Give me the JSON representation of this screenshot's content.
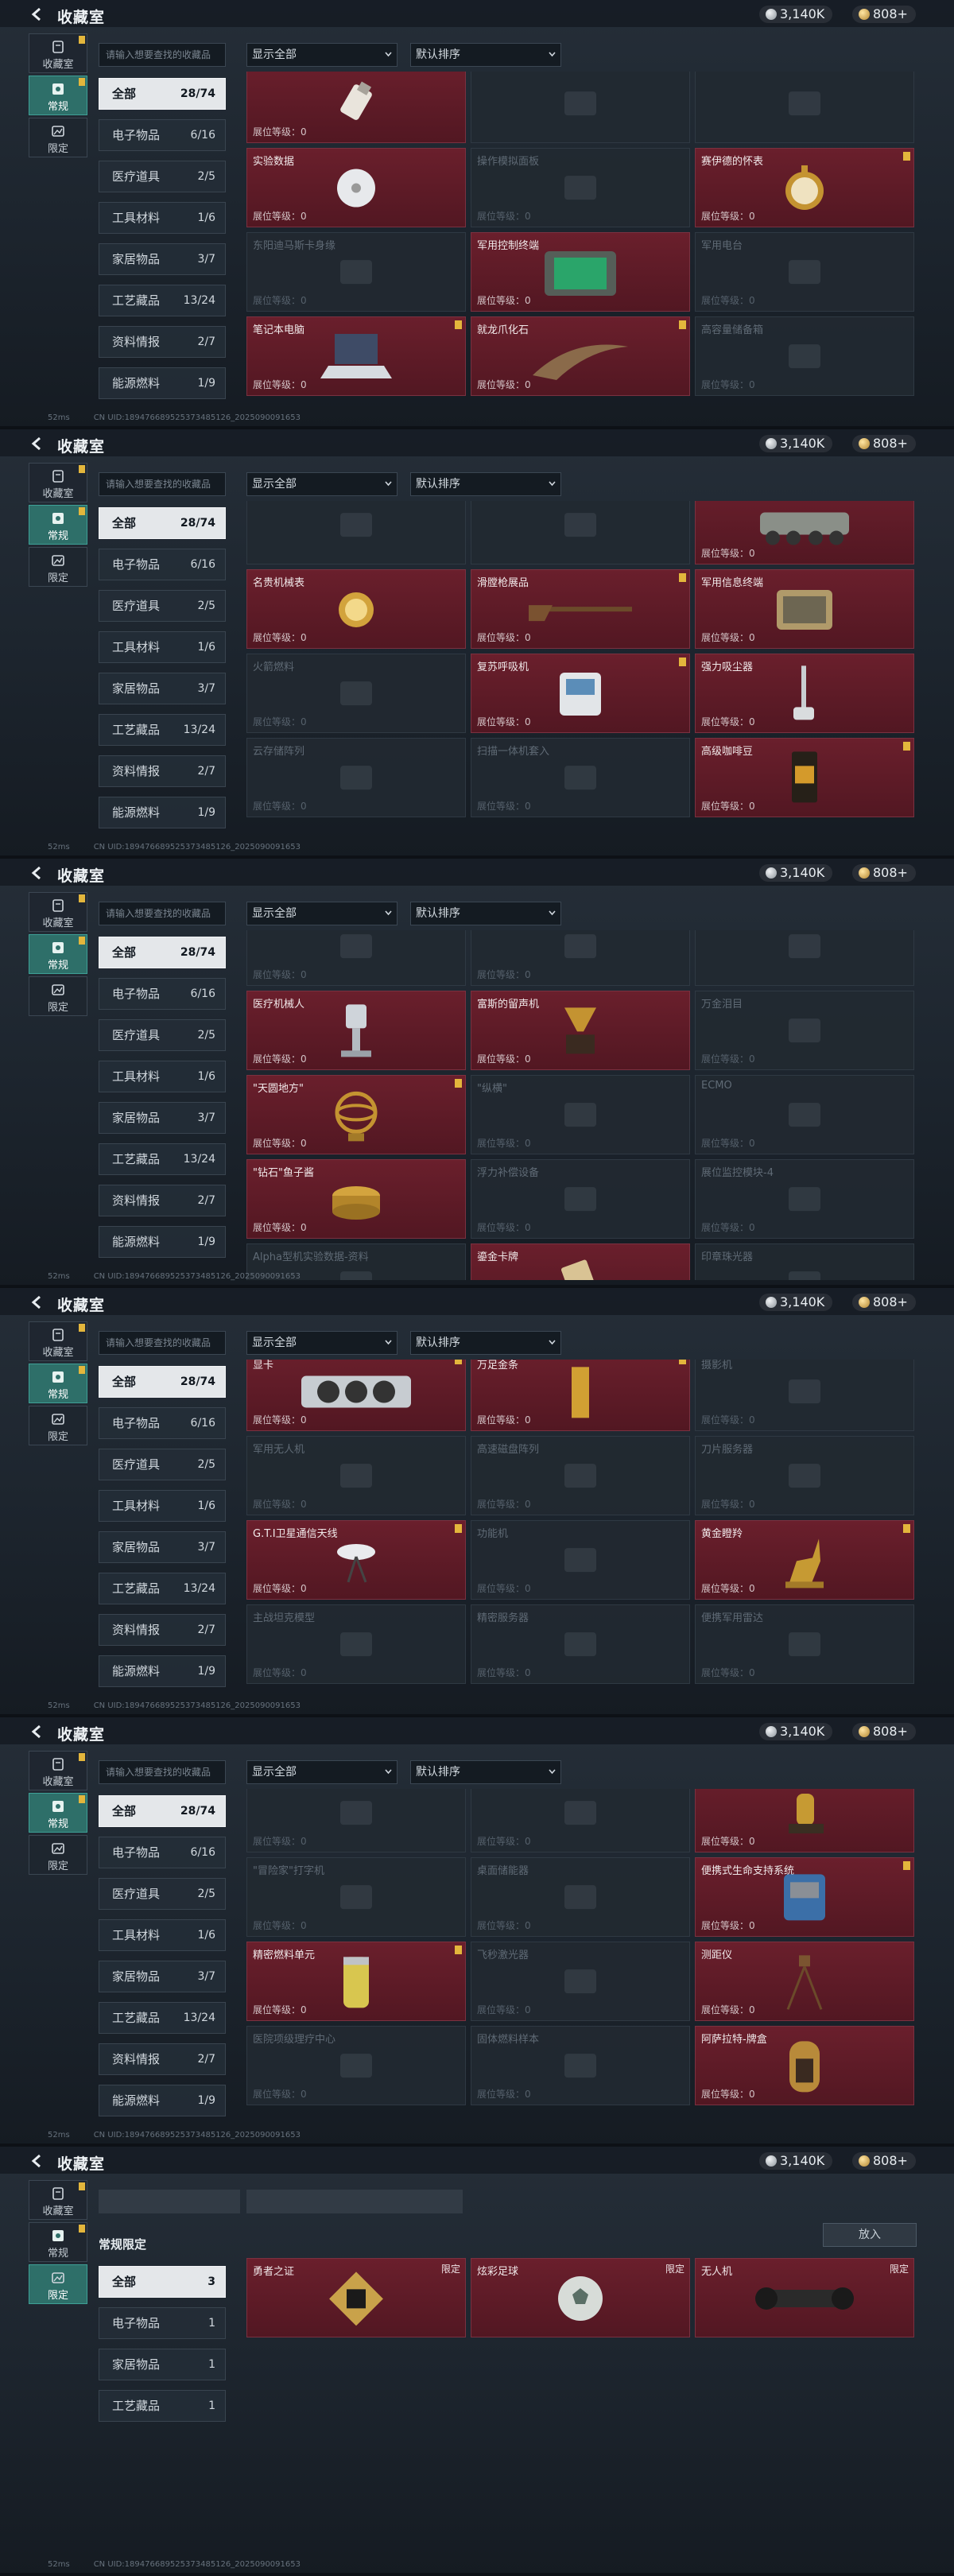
{
  "header": {
    "title": "收藏室",
    "silver_amount": "3,140K",
    "gold_amount": "808+"
  },
  "sidebar": [
    {
      "label": "收藏室",
      "icon": "collection-room-icon"
    },
    {
      "label": "常规",
      "icon": "regular-icon"
    },
    {
      "label": "限定",
      "icon": "limited-icon"
    }
  ],
  "filters": {
    "search_placeholder": "请输入想要查找的收藏品",
    "show_all": "显示全部",
    "sort": "默认排序"
  },
  "categories": [
    {
      "label": "全部",
      "count": "28/74"
    },
    {
      "label": "电子物品",
      "count": "6/16"
    },
    {
      "label": "医疗道具",
      "count": "2/5"
    },
    {
      "label": "工具材料",
      "count": "1/6"
    },
    {
      "label": "家居物品",
      "count": "3/7"
    },
    {
      "label": "工艺藏品",
      "count": "13/24"
    },
    {
      "label": "资料情报",
      "count": "2/7"
    },
    {
      "label": "能源燃料",
      "count": "1/9"
    }
  ],
  "level_label": "展位等级：",
  "footer": {
    "ping": "52ms",
    "uid": "CN UID:189476689525373485126_2025090091653"
  },
  "screens": [
    [
      {
        "name": "",
        "owned": true,
        "level": "0",
        "icon": "usb-drive"
      },
      {
        "name": "",
        "owned": false,
        "level": "",
        "icon": "none"
      },
      {
        "name": "",
        "owned": false,
        "level": "",
        "icon": "none"
      },
      {
        "name": "实验数据",
        "owned": true,
        "level": "0",
        "icon": "disc"
      },
      {
        "name": "操作模拟面板",
        "owned": false,
        "level": "0",
        "icon": "none"
      },
      {
        "name": "赛伊德的怀表",
        "owned": true,
        "level": "0",
        "icon": "pocket-watch",
        "badge": true
      },
      {
        "name": "东阳迪马斯卡身缘",
        "owned": false,
        "level": "0",
        "icon": "none"
      },
      {
        "name": "军用控制终端",
        "owned": true,
        "level": "0",
        "icon": "control-terminal"
      },
      {
        "name": "军用电台",
        "owned": false,
        "level": "0",
        "icon": "none"
      },
      {
        "name": "笔记本电脑",
        "owned": true,
        "level": "0",
        "icon": "laptop",
        "badge": true
      },
      {
        "name": "就龙爪化石",
        "owned": true,
        "level": "0",
        "icon": "claw-fossil",
        "badge": true
      },
      {
        "name": "高容量储备箱",
        "owned": false,
        "level": "0",
        "icon": "none"
      }
    ],
    [
      {
        "name": "",
        "owned": false,
        "level": "",
        "icon": "none"
      },
      {
        "name": "",
        "owned": false,
        "level": "",
        "icon": "none"
      },
      {
        "name": "",
        "owned": true,
        "level": "0",
        "icon": "armored-vehicle"
      },
      {
        "name": "名贵机械表",
        "owned": true,
        "level": "0",
        "icon": "gold-watch"
      },
      {
        "name": "滑膛枪展品",
        "owned": true,
        "level": "0",
        "icon": "musket",
        "badge": true
      },
      {
        "name": "军用信息终端",
        "owned": true,
        "level": "0",
        "icon": "field-case"
      },
      {
        "name": "火箭燃料",
        "owned": false,
        "level": "0",
        "icon": "none"
      },
      {
        "name": "复苏呼吸机",
        "owned": true,
        "level": "0",
        "icon": "ventilator",
        "badge": true
      },
      {
        "name": "强力吸尘器",
        "owned": true,
        "level": "0",
        "icon": "vacuum"
      },
      {
        "name": "云存储阵列",
        "owned": false,
        "level": "0",
        "icon": "none"
      },
      {
        "name": "扫描一体机套入",
        "owned": false,
        "level": "0",
        "icon": "none"
      },
      {
        "name": "高级咖啡豆",
        "owned": true,
        "level": "0",
        "icon": "coffee-bag",
        "badge": true
      }
    ],
    [
      {
        "name": "",
        "owned": false,
        "level": "0",
        "icon": "none"
      },
      {
        "name": "",
        "owned": false,
        "level": "0",
        "icon": "none"
      },
      {
        "name": "",
        "owned": false,
        "level": "",
        "icon": "none"
      },
      {
        "name": "医疗机械人",
        "owned": true,
        "level": "0",
        "icon": "medical-robot"
      },
      {
        "name": "富斯的留声机",
        "owned": true,
        "level": "0",
        "icon": "gramophone"
      },
      {
        "name": "万金泪目",
        "owned": false,
        "level": "0",
        "icon": "none"
      },
      {
        "name": "\"天圆地方\"",
        "owned": true,
        "level": "0",
        "icon": "armillary",
        "badge": true
      },
      {
        "name": "\"纵横\"",
        "owned": false,
        "level": "0",
        "icon": "none"
      },
      {
        "name": "ECMO",
        "owned": false,
        "level": "0",
        "icon": "none"
      },
      {
        "name": "\"钻石\"鱼子酱",
        "owned": true,
        "level": "0",
        "icon": "caviar"
      },
      {
        "name": "浮力补偿设备",
        "owned": false,
        "level": "0",
        "icon": "none"
      },
      {
        "name": "展位监控模块-4",
        "owned": false,
        "level": "0",
        "icon": "none"
      },
      {
        "name": "Alpha型机实验数据-资料",
        "owned": false,
        "level": "",
        "icon": "none"
      },
      {
        "name": "鎏金卡牌",
        "owned": true,
        "level": "",
        "icon": "gold-card"
      },
      {
        "name": "印章珠光器",
        "owned": false,
        "level": "",
        "icon": "none"
      }
    ],
    [
      {
        "name": "显卡",
        "owned": true,
        "level": "0",
        "icon": "gpu",
        "badge": true
      },
      {
        "name": "万足金条",
        "owned": true,
        "level": "0",
        "icon": "gold-bar",
        "badge": true
      },
      {
        "name": "摄影机",
        "owned": false,
        "level": "0",
        "icon": "none"
      },
      {
        "name": "军用无人机",
        "owned": false,
        "level": "0",
        "icon": "none"
      },
      {
        "name": "高速磁盘阵列",
        "owned": false,
        "level": "0",
        "icon": "none"
      },
      {
        "name": "刀片服务器",
        "owned": false,
        "level": "0",
        "icon": "none"
      },
      {
        "name": "G.T.I卫星通信天线",
        "owned": true,
        "level": "0",
        "icon": "satellite-dish",
        "badge": true
      },
      {
        "name": "功能机",
        "owned": false,
        "level": "0",
        "icon": "none"
      },
      {
        "name": "黄金瞪羚",
        "owned": true,
        "level": "0",
        "icon": "gold-gazelle",
        "badge": true
      },
      {
        "name": "主战坦克模型",
        "owned": false,
        "level": "0",
        "icon": "none"
      },
      {
        "name": "精密服务器",
        "owned": false,
        "level": "0",
        "icon": "none"
      },
      {
        "name": "便携军用雷达",
        "owned": false,
        "level": "0",
        "icon": "none"
      }
    ],
    [
      {
        "name": "",
        "owned": false,
        "level": "0",
        "icon": "none"
      },
      {
        "name": "",
        "owned": false,
        "level": "0",
        "icon": "none"
      },
      {
        "name": "",
        "owned": true,
        "level": "0",
        "icon": "gold-statue"
      },
      {
        "name": "\"冒险家\"打字机",
        "owned": false,
        "level": "0",
        "icon": "none"
      },
      {
        "name": "桌面储能器",
        "owned": false,
        "level": "0",
        "icon": "none"
      },
      {
        "name": "便携式生命支持系统",
        "owned": true,
        "level": "0",
        "icon": "life-support",
        "badge": true
      },
      {
        "name": "精密燃料单元",
        "owned": true,
        "level": "0",
        "icon": "fuel-cell",
        "badge": true
      },
      {
        "name": "飞秒激光器",
        "owned": false,
        "level": "0",
        "icon": "none"
      },
      {
        "name": "测距仪",
        "owned": true,
        "level": "0",
        "icon": "tripod"
      },
      {
        "name": "医院项级理疗中心",
        "owned": false,
        "level": "0",
        "icon": "none"
      },
      {
        "name": "固体燃料样本",
        "owned": false,
        "level": "0",
        "icon": "none"
      },
      {
        "name": "阿萨拉特-牌盒",
        "owned": true,
        "level": "0",
        "icon": "jukebox"
      }
    ]
  ],
  "limited": {
    "section_title": "常规限定",
    "put_label": "放入",
    "categories": [
      {
        "label": "全部",
        "count": "3"
      },
      {
        "label": "电子物品",
        "count": "1"
      },
      {
        "label": "家居物品",
        "count": "1"
      },
      {
        "label": "工艺藏品",
        "count": "1"
      }
    ],
    "items": [
      {
        "name": "勇者之证",
        "tag": "限定",
        "icon": "gold-emblem"
      },
      {
        "name": "炫彩足球",
        "tag": "限定",
        "icon": "soccer-ball"
      },
      {
        "name": "无人机",
        "tag": "限定",
        "icon": "black-drone"
      }
    ]
  }
}
